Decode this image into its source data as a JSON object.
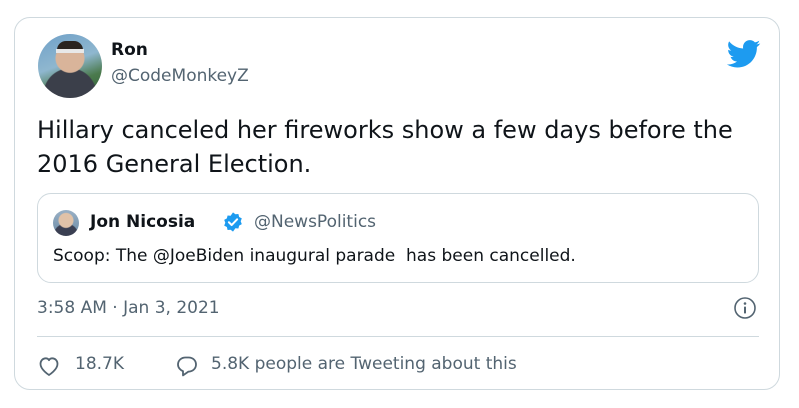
{
  "author": {
    "display_name": "Ron",
    "handle": "@CodeMonkeyZ",
    "avatar_icon": "user-avatar"
  },
  "tweet": {
    "text": "Hillary canceled her fireworks show a few days before the 2016 General Election.",
    "timestamp": "3:58 AM · Jan 3, 2021"
  },
  "quoted_tweet": {
    "display_name": "Jon Nicosia",
    "verified": true,
    "handle": "@NewsPolitics",
    "text": "Scoop: The @JoeBiden inaugural parade  has been cancelled."
  },
  "engagement": {
    "likes": "18.7K",
    "tweeting": "5.8K people are Tweeting about this"
  },
  "colors": {
    "brand_blue": "#1d9bf0",
    "secondary_text": "#536471",
    "border": "#cfd9de"
  }
}
